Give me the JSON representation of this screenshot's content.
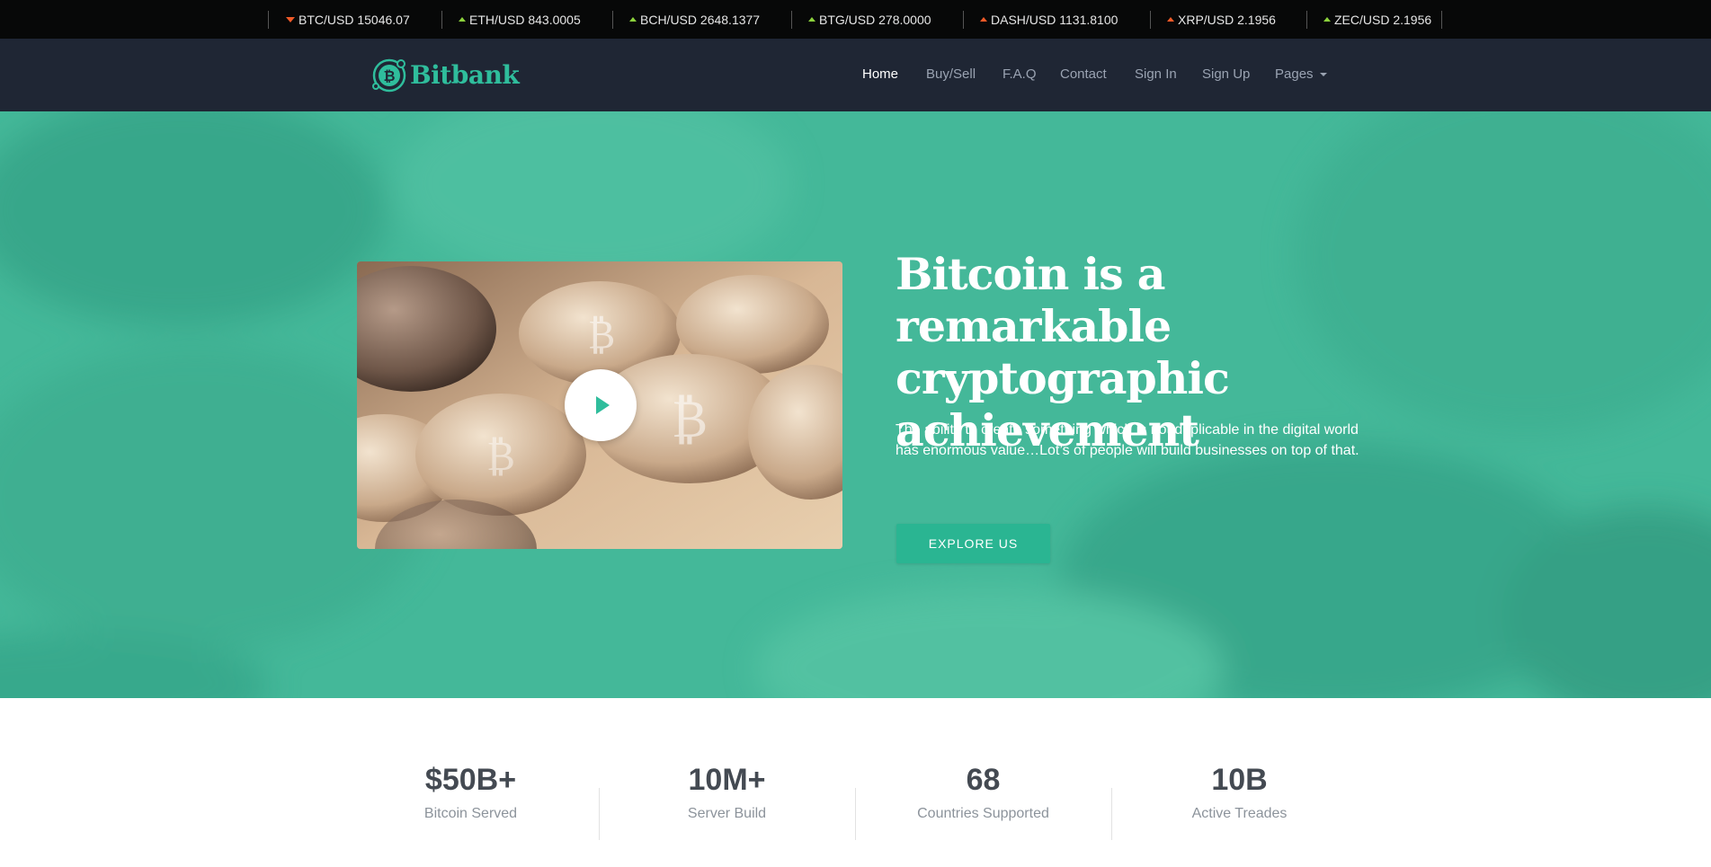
{
  "ticker": [
    {
      "pair": "BTC/USD",
      "price": "15046.07",
      "trend": "down"
    },
    {
      "pair": "ETH/USD",
      "price": "843.0005",
      "trend": "up"
    },
    {
      "pair": "BCH/USD",
      "price": "2648.1377",
      "trend": "up"
    },
    {
      "pair": "BTG/USD",
      "price": "278.0000",
      "trend": "up"
    },
    {
      "pair": "DASH/USD",
      "price": "1131.8100",
      "trend": "up-red"
    },
    {
      "pair": "XRP/USD",
      "price": "2.1956",
      "trend": "up-red"
    },
    {
      "pair": "ZEC/USD",
      "price": "2.1956",
      "trend": "up"
    }
  ],
  "brand": {
    "name": "Bitbank",
    "color": "#2fbd9c"
  },
  "nav": {
    "home": "Home",
    "buy_sell": "Buy/Sell",
    "faq": "F.A.Q",
    "contact": "Contact",
    "sign_in": "Sign In",
    "sign_up": "Sign Up",
    "pages": "Pages"
  },
  "hero": {
    "title": "Bitcoin is a remarkable cryptographic achievement",
    "text": "The ability to create something which is not duplicable in the digital world has enormous value…Lot’s of people will build businesses on top of that.",
    "button": "EXPLORE US",
    "accent": "#42b597"
  },
  "stats": [
    {
      "value": "$50B+",
      "label": "Bitcoin Served"
    },
    {
      "value": "10M+",
      "label": "Server Build"
    },
    {
      "value": "68",
      "label": "Countries Supported"
    },
    {
      "value": "10B",
      "label": "Active Treades"
    }
  ]
}
